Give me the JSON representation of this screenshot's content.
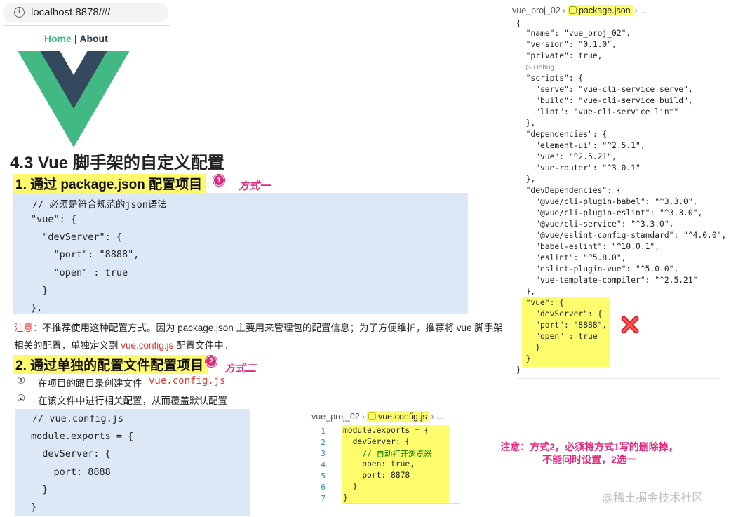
{
  "browser": {
    "url": "localhost:8878/#/"
  },
  "app_nav": {
    "home": "Home",
    "separator": " | ",
    "about": "About"
  },
  "colors": {
    "vue_green": "#42b983",
    "vue_dark": "#35495e",
    "highlight": "#fdfc6d",
    "annotation_pink": "#e6267c",
    "note_red": "#e53935",
    "code_bg": "#dde8f7"
  },
  "article": {
    "title": "4.3 Vue 脚手架的自定义配置",
    "section1": {
      "heading": "1. 通过 package.json 配置项目",
      "badge": "1",
      "handwritten": "方式一"
    },
    "code1": [
      "// 必须是符合规范的json语法",
      "\"vue\": {",
      "  \"devServer\": {",
      "    \"port\": \"8888\",",
      "    \"open\" : true",
      "  }",
      "},"
    ],
    "note": {
      "label": "注意：",
      "text_a": "不推荐使用这种配置方式。因为 package.json 主要用来管理包的配置信息；为了方便维护，推荐将 vue 脚手架相关的配置，单独定义到 ",
      "file": "vue.config.js",
      "text_b": " 配置文件中。"
    },
    "section2": {
      "heading": "2. 通过单独的配置文件配置项目",
      "badge": "2",
      "handwritten": "方式二"
    },
    "steps": [
      {
        "num": "①",
        "text": "在项目的跟目录创建文件",
        "code": "vue.config.js"
      },
      {
        "num": "②",
        "text": "在该文件中进行相关配置，从而覆盖默认配置"
      }
    ],
    "code2": [
      "// vue.config.js",
      "module.exports = {",
      "  devServer: {",
      "    port: 8888",
      "  }",
      "}"
    ]
  },
  "pkg_editor": {
    "crumb_folder": "vue_proj_02",
    "crumb_file": "package.json",
    "crumb_more": "...",
    "icon": "json-file-icon",
    "debug_lens": "▷ Debug",
    "lines": [
      "{",
      "  \"name\": \"vue_proj_02\",",
      "  \"version\": \"0.1.0\",",
      "  \"private\": true,",
      "  \"scripts\": {",
      "    \"serve\": \"vue-cli-service serve\",",
      "    \"build\": \"vue-cli-service build\",",
      "    \"lint\": \"vue-cli-service lint\"",
      "  },",
      "  \"dependencies\": {",
      "    \"element-ui\": \"^2.5.1\",",
      "    \"vue\": \"^2.5.21\",",
      "    \"vue-router\": \"^3.0.1\"",
      "  },",
      "  \"devDependencies\": {",
      "    \"@vue/cli-plugin-babel\": \"^3.3.0\",",
      "    \"@vue/cli-plugin-eslint\": \"^3.3.0\",",
      "    \"@vue/cli-service\": \"^3.3.0\",",
      "    \"@vue/eslint-config-standard\": \"^4.0.0\",",
      "    \"babel-eslint\": \"^10.0.1\",",
      "    \"eslint\": \"^5.8.0\",",
      "    \"eslint-plugin-vue\": \"^5.0.0\",",
      "    \"vue-template-compiler\": \"^2.5.21\"",
      "  },",
      "  \"vue\": {",
      "    \"devServer\": {",
      "    \"port\": \"8888\",",
      "    \"open\" : true",
      "    }",
      "  }",
      "}"
    ]
  },
  "cfg_editor": {
    "crumb_folder": "vue_proj_02",
    "crumb_file": "vue.config.js",
    "crumb_more": "...",
    "icon": "js-file-icon",
    "line_numbers": [
      "1",
      "2",
      "3",
      "4",
      "5",
      "6",
      "7"
    ],
    "lines": [
      "module.exports = {",
      "  devServer: {",
      "    // 自动打开浏览器",
      "    open: true,",
      "    port: 8878",
      "  }",
      "}"
    ]
  },
  "side_note": {
    "line1": "注意：方式2，必须将方式1写的删除掉，",
    "line2": "不能同时设置，2选一"
  },
  "watermark": "@稀土掘金技术社区"
}
